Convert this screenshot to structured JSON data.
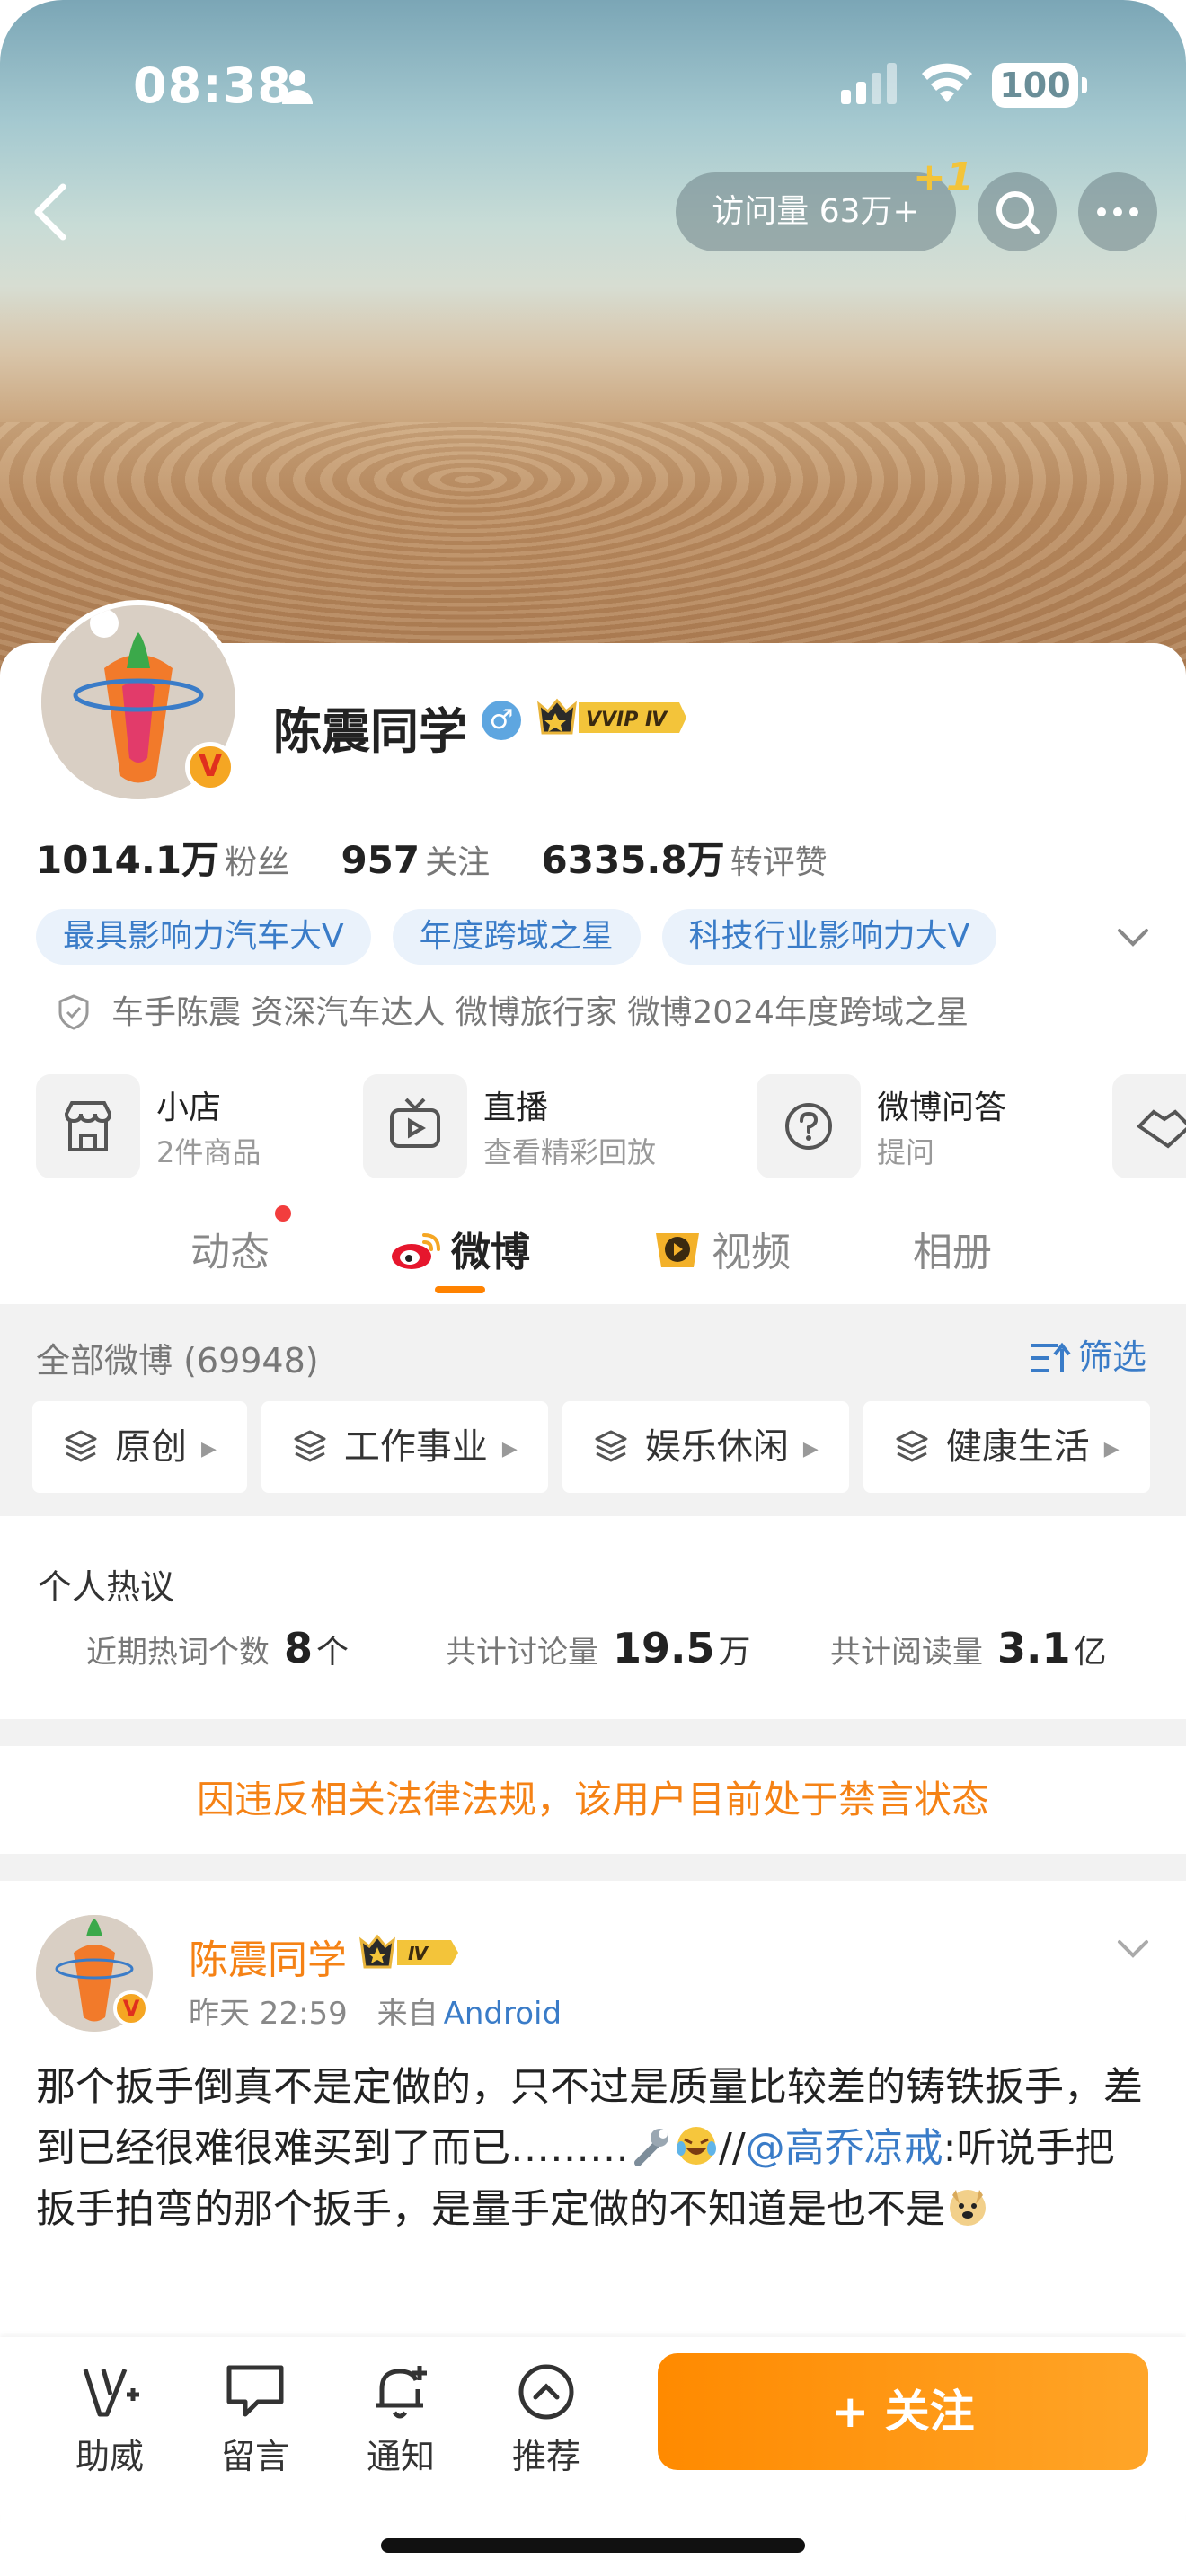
{
  "status_bar": {
    "time": "08:38",
    "battery": "100"
  },
  "header": {
    "visits": "访问量 63万+",
    "visits_badge": "+1"
  },
  "profile": {
    "name": "陈震同学",
    "gender": "♂",
    "vip_badge": "VVIP Ⅳ",
    "avatar_badge": "V",
    "stats": [
      {
        "value": "1014.1万",
        "label": "粉丝"
      },
      {
        "value": "957",
        "label": "关注"
      },
      {
        "value": "6335.8万",
        "label": "转评赞"
      }
    ],
    "tags": [
      "最具影响力汽车大V",
      "年度跨域之星",
      "科技行业影响力大V"
    ],
    "verification": "车手陈震 资深汽车达人  微博旅行家 微博2024年度跨域之星"
  },
  "services": [
    {
      "title": "小店",
      "subtitle": "2件商品",
      "icon": "shop-icon"
    },
    {
      "title": "直播",
      "subtitle": "查看精彩回放",
      "icon": "tv-icon"
    },
    {
      "title": "微博问答",
      "subtitle": "提问",
      "icon": "question-icon"
    }
  ],
  "tabs": [
    {
      "label": "动态",
      "active": false,
      "has_dot": true
    },
    {
      "label": "微博",
      "active": true
    },
    {
      "label": "视频",
      "active": false
    },
    {
      "label": "相册",
      "active": false
    }
  ],
  "feed_filter": {
    "all_count": "全部微博 (69948)",
    "filter_label": "筛选",
    "chips": [
      "原创",
      "工作事业",
      "娱乐休闲",
      "健康生活"
    ]
  },
  "hot_topics": {
    "title": "个人热议",
    "items": [
      {
        "label": "近期热词个数",
        "value": "8",
        "unit": "个"
      },
      {
        "label": "共计讨论量",
        "value": "19.5",
        "unit": "万"
      },
      {
        "label": "共计阅读量",
        "value": "3.1",
        "unit": "亿"
      }
    ]
  },
  "banned_notice": "因违反相关法律法规，该用户目前处于禁言状态",
  "post": {
    "author": "陈震同学",
    "level_badge": "Ⅳ",
    "time": "昨天 22:59",
    "source_prefix": "来自",
    "source": "Android",
    "text_part1": "那个扳手倒真不是定做的，只不过是质量比较差的铸铁扳手，差到已经很难很难买到了而已………",
    "repost_sep": "//",
    "mention": "@高乔凉戒",
    "text_part2": ":听说手把扳手拍弯的那个扳手，是量手定做的不知道是也不是"
  },
  "bottom_bar": {
    "items": [
      {
        "label": "助威",
        "icon": "cheer-icon"
      },
      {
        "label": "留言",
        "icon": "message-icon"
      },
      {
        "label": "通知",
        "icon": "bell-icon"
      },
      {
        "label": "推荐",
        "icon": "recommend-icon"
      }
    ],
    "follow_label": "+ 关注"
  },
  "colors": {
    "accent": "#ff8200",
    "link": "#3a7cc8",
    "banned": "#f58215"
  }
}
